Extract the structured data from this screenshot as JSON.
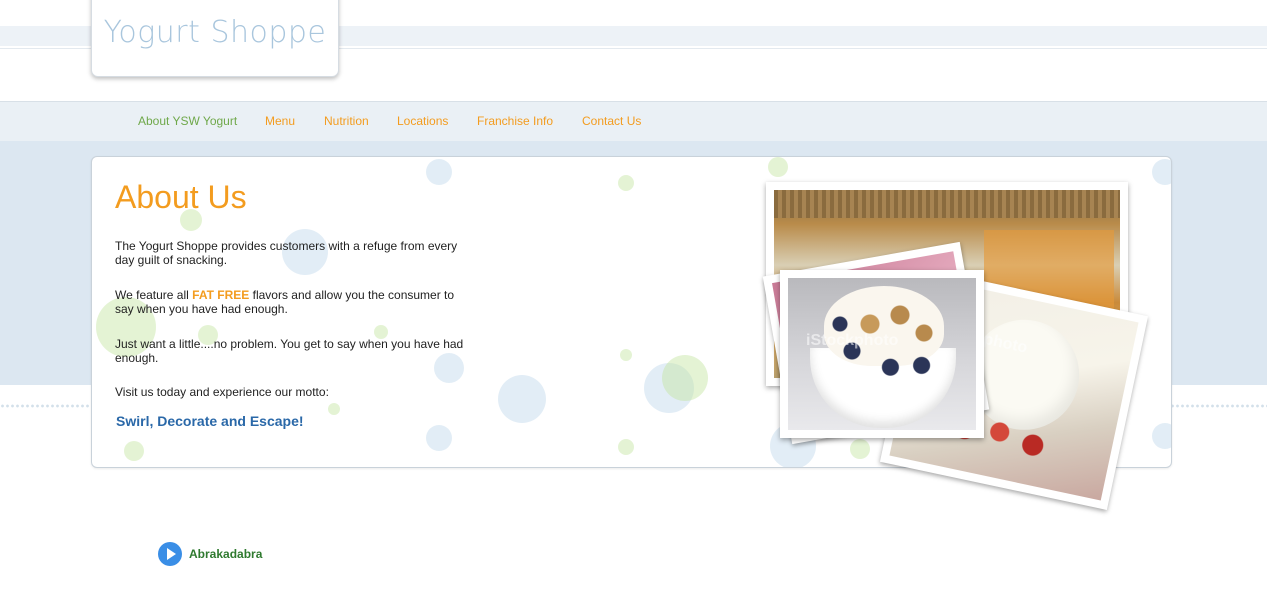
{
  "brand": {
    "logo_text": "Yogurt Shoppe"
  },
  "nav": {
    "items": [
      {
        "label": "About YSW Yogurt",
        "active": true
      },
      {
        "label": "Menu",
        "active": false
      },
      {
        "label": "Nutrition",
        "active": false
      },
      {
        "label": "Locations",
        "active": false
      },
      {
        "label": "Franchise Info",
        "active": false
      },
      {
        "label": "Contact Us",
        "active": false
      }
    ]
  },
  "content": {
    "title": "About Us",
    "paragraphs": {
      "p1": "The Yogurt Shoppe provides customers with a refuge from every day guilt of snacking.",
      "p2_before": "We feature all ",
      "p2_highlight": "FAT FREE",
      "p2_after": " flavors and allow you the consumer to say when you have had enough.",
      "p3": "Just want a little....no problem. You get to say when you have had enough.",
      "p4": "Visit us today and experience our motto:"
    },
    "motto": "Swirl, Decorate and Escape!"
  },
  "gallery": {
    "watermark": "iStockphoto"
  },
  "audio": {
    "track": "Abrakadabra"
  },
  "colors": {
    "accent_orange": "#f39c1f",
    "nav_active_green": "#6fa84a",
    "motto_blue": "#2a68a8",
    "backdrop_blue": "#dce7f1",
    "play_blue": "#3a8ee6",
    "track_green": "#2f7a2f"
  },
  "icons": {
    "play": "play-icon"
  }
}
